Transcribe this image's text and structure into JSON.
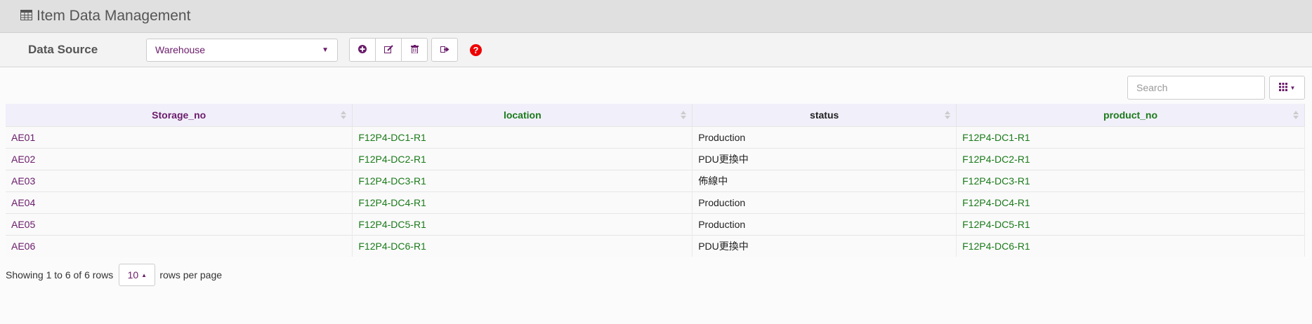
{
  "header": {
    "title": "Item Data Management"
  },
  "toolbar": {
    "data_source_label": "Data Source",
    "data_source_value": "Warehouse",
    "buttons": [
      "add-icon",
      "edit-icon",
      "delete-icon",
      "export-icon"
    ],
    "help_glyph": "?"
  },
  "search": {
    "placeholder": "Search"
  },
  "table": {
    "columns": [
      "Storage_no",
      "location",
      "status",
      "product_no"
    ],
    "rows": [
      [
        "AE01",
        "F12P4-DC1-R1",
        "Production",
        "F12P4-DC1-R1"
      ],
      [
        "AE02",
        "F12P4-DC2-R1",
        "PDU更換中",
        "F12P4-DC2-R1"
      ],
      [
        "AE03",
        "F12P4-DC3-R1",
        "佈線中",
        "F12P4-DC3-R1"
      ],
      [
        "AE04",
        "F12P4-DC4-R1",
        "Production",
        "F12P4-DC4-R1"
      ],
      [
        "AE05",
        "F12P4-DC5-R1",
        "Production",
        "F12P4-DC5-R1"
      ],
      [
        "AE06",
        "F12P4-DC6-R1",
        "PDU更換中",
        "F12P4-DC6-R1"
      ]
    ]
  },
  "footer": {
    "showing": "Showing 1 to 6 of 6 rows",
    "page_size": "10",
    "rows_per_page": "rows per page"
  },
  "colors": {
    "accent": "#6a1b6a",
    "green": "#1a7a1a",
    "help": "#e00000"
  }
}
